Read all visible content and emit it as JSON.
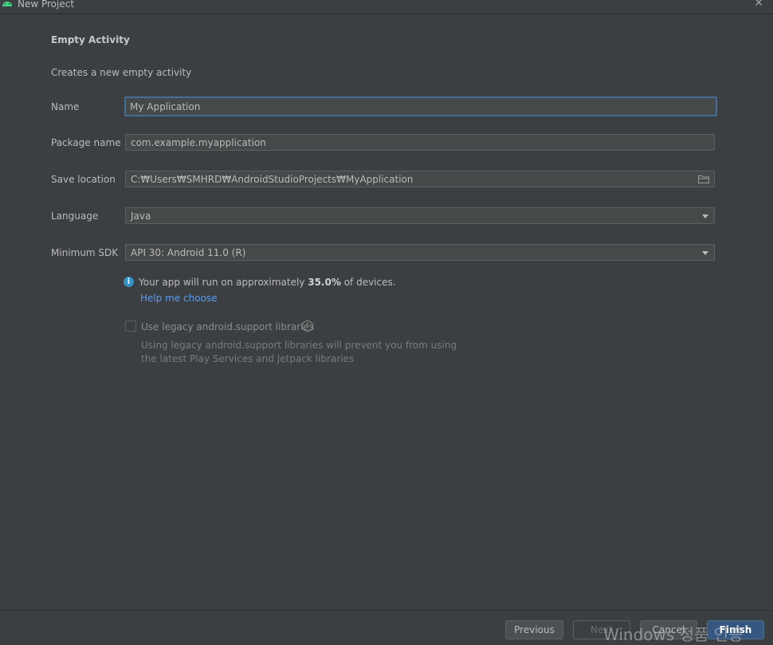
{
  "window": {
    "title": "New Project",
    "close_glyph": "✕"
  },
  "page": {
    "heading": "Empty Activity",
    "subheading": "Creates a new empty activity"
  },
  "form": {
    "name": {
      "label": "Name",
      "value": "My Application"
    },
    "package": {
      "label": "Package name",
      "value": "com.example.myapplication"
    },
    "save_location": {
      "label": "Save location",
      "value": "C:₩Users₩SMHRD₩AndroidStudioProjects₩MyApplication"
    },
    "language": {
      "label": "Language",
      "value": "Java"
    },
    "min_sdk": {
      "label": "Minimum SDK",
      "value": "API 30: Android 11.0 (R)"
    }
  },
  "info": {
    "text_before": "Your app will run on approximately ",
    "percent": "35.0%",
    "text_after": " of devices.",
    "help_link": "Help me choose"
  },
  "legacy": {
    "checkbox_label": "Use legacy android.support libraries",
    "checked": false,
    "description_line1": "Using legacy android.support libraries will prevent you from using",
    "description_line2": "the latest Play Services and Jetpack libraries"
  },
  "footer": {
    "previous": "Previous",
    "next": "Next",
    "cancel": "Cancel",
    "finish": "Finish"
  },
  "watermark": "Windows 정품 인증",
  "colors": {
    "accent": "#466d94",
    "link": "#589df6",
    "primary_button": "#365880",
    "background": "#3c3f41"
  }
}
